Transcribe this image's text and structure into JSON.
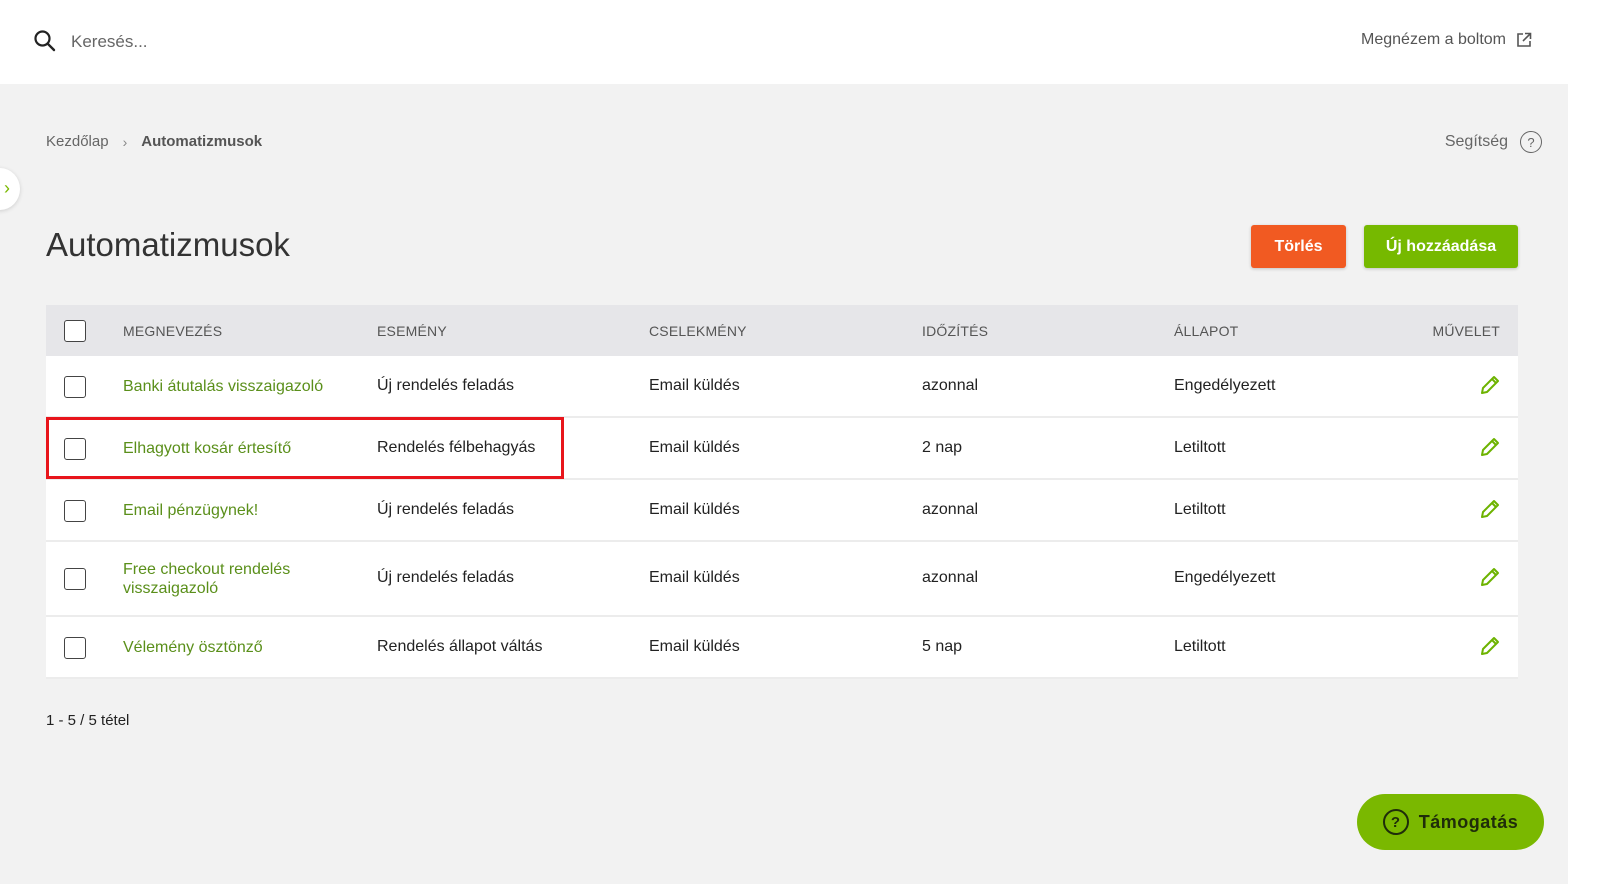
{
  "topbar": {
    "search_placeholder": "Keresés...",
    "shop_link": "Megnézem a boltom"
  },
  "breadcrumb": {
    "home": "Kezdőlap",
    "current": "Automatizmusok"
  },
  "help_label": "Segítség",
  "page_title": "Automatizmusok",
  "buttons": {
    "delete": "Törlés",
    "add": "Új hozzáadása"
  },
  "table": {
    "headers": [
      "MEGNEVEZÉS",
      "ESEMÉNY",
      "CSELEKMÉNY",
      "IDŐZÍTÉS",
      "ÁLLAPOT",
      "MŰVELET"
    ],
    "rows": [
      {
        "name": "Banki átutalás visszaigazoló",
        "event": "Új rendelés feladás",
        "action": "Email küldés",
        "timing": "azonnal",
        "status": "Engedélyezett"
      },
      {
        "name": "Elhagyott kosár értesítő",
        "event": "Rendelés félbehagyás",
        "action": "Email küldés",
        "timing": "2 nap",
        "status": "Letiltott"
      },
      {
        "name": "Email pénzügynek!",
        "event": "Új rendelés feladás",
        "action": "Email küldés",
        "timing": "azonnal",
        "status": "Letiltott"
      },
      {
        "name": "Free checkout rendelés visszaigazoló",
        "event": "Új rendelés feladás",
        "action": "Email küldés",
        "timing": "azonnal",
        "status": "Engedélyezett"
      },
      {
        "name": "Vélemény ösztönző",
        "event": "Rendelés állapot váltás",
        "action": "Email küldés",
        "timing": "5 nap",
        "status": "Letiltott"
      }
    ]
  },
  "item_count": "1 - 5 / 5 tétel",
  "support_label": "Támogatás",
  "colors": {
    "accent_green": "#76b900",
    "delete_orange": "#f15a22",
    "link_green": "#5a8f1a",
    "highlight_red": "#e8151b"
  }
}
